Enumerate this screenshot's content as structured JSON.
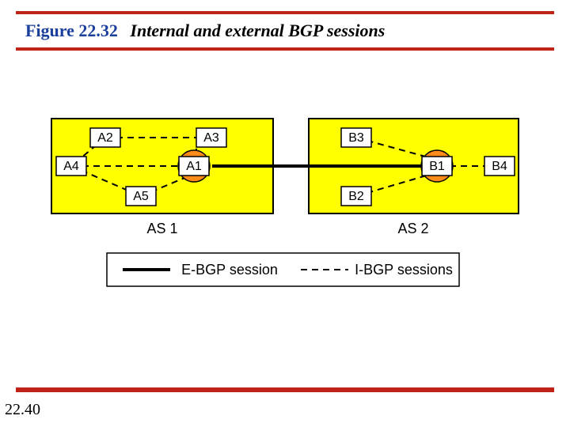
{
  "figure": {
    "label": "Figure 22.32",
    "caption": "Internal and external BGP sessions"
  },
  "page_number": "22.40",
  "as1": {
    "label": "AS 1",
    "nodes": {
      "A1": "A1",
      "A2": "A2",
      "A3": "A3",
      "A4": "A4",
      "A5": "A5"
    }
  },
  "as2": {
    "label": "AS 2",
    "nodes": {
      "B1": "B1",
      "B2": "B2",
      "B3": "B3",
      "B4": "B4"
    }
  },
  "legend": {
    "ebgp": "E-BGP session",
    "ibgp": "I-BGP sessions"
  }
}
